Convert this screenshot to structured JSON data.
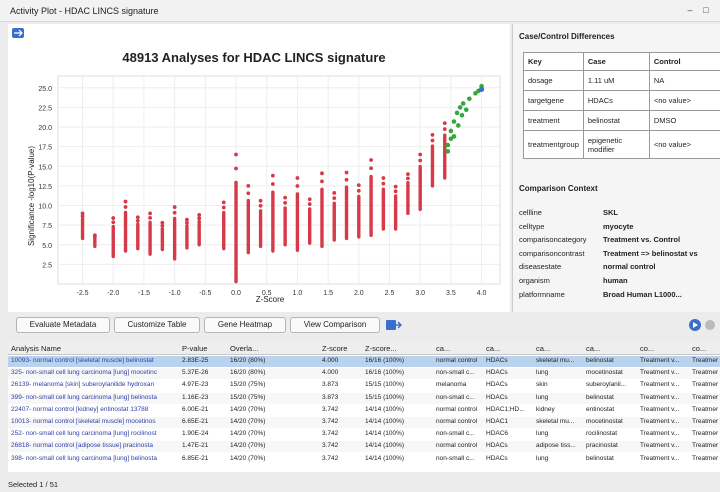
{
  "window": {
    "title": "Activity Plot - HDAC LINCS signature"
  },
  "plot": {
    "title": "48913 Analyses for HDAC LINCS signature",
    "xlabel": "Z-Score",
    "ylabel": "Significance -log10(P-value)",
    "xticks": [
      "-2.5",
      "-2.0",
      "-1.5",
      "-1.0",
      "-0.5",
      "0.0",
      "0.5",
      "1.0",
      "1.5",
      "2.0",
      "2.5",
      "3.0",
      "3.5",
      "4.0"
    ],
    "yticks": [
      "2.5",
      "5.0",
      "7.5",
      "10.0",
      "12.5",
      "15.0",
      "17.5",
      "20.0",
      "22.5",
      "25.0"
    ],
    "colors": {
      "default": "#d63a48",
      "highlight": "#33a93a",
      "selected": "#3a6fc9"
    }
  },
  "chart_data": {
    "type": "scatter",
    "title": "48913 Analyses for HDAC LINCS signature",
    "xlabel": "Z-Score",
    "ylabel": "Significance -log10(P-value)",
    "xlim": [
      -2.9,
      4.3
    ],
    "ylim": [
      0,
      26.5
    ],
    "series": [
      {
        "values_kind": "columns",
        "columns": [
          {
            "x": -2.5,
            "ymin": 5.8,
            "ymax": 9.0
          },
          {
            "x": -2.3,
            "ymin": 4.8,
            "ymax": 6.2
          },
          {
            "x": -2.0,
            "ymin": 3.5,
            "ymax": 8.4
          },
          {
            "x": -1.8,
            "ymin": 4.2,
            "ymax": 10.5
          },
          {
            "x": -1.6,
            "ymin": 4.5,
            "ymax": 8.5
          },
          {
            "x": -1.4,
            "ymin": 3.8,
            "ymax": 9.0
          },
          {
            "x": -1.2,
            "ymin": 4.4,
            "ymax": 7.8
          },
          {
            "x": -1.0,
            "ymin": 3.2,
            "ymax": 9.8
          },
          {
            "x": -0.8,
            "ymin": 4.6,
            "ymax": 8.2
          },
          {
            "x": -0.6,
            "ymin": 5.0,
            "ymax": 8.8
          },
          {
            "x": -0.2,
            "ymin": 4.5,
            "ymax": 10.4
          },
          {
            "x": 0.0,
            "ymin": 0.3,
            "ymax": 16.5
          },
          {
            "x": 0.2,
            "ymin": 4.0,
            "ymax": 12.5
          },
          {
            "x": 0.4,
            "ymin": 4.8,
            "ymax": 10.6
          },
          {
            "x": 0.6,
            "ymin": 4.2,
            "ymax": 13.8
          },
          {
            "x": 0.8,
            "ymin": 5.0,
            "ymax": 11.0
          },
          {
            "x": 1.0,
            "ymin": 4.3,
            "ymax": 13.5
          },
          {
            "x": 1.2,
            "ymin": 5.2,
            "ymax": 10.8
          },
          {
            "x": 1.4,
            "ymin": 4.8,
            "ymax": 14.1
          },
          {
            "x": 1.6,
            "ymin": 5.6,
            "ymax": 11.6
          },
          {
            "x": 1.8,
            "ymin": 5.8,
            "ymax": 14.2
          },
          {
            "x": 2.0,
            "ymin": 6.0,
            "ymax": 12.6
          },
          {
            "x": 2.2,
            "ymin": 6.2,
            "ymax": 15.8
          },
          {
            "x": 2.4,
            "ymin": 7.0,
            "ymax": 13.5
          },
          {
            "x": 2.6,
            "ymin": 7.0,
            "ymax": 12.4
          },
          {
            "x": 2.8,
            "ymin": 9.0,
            "ymax": 14.0
          },
          {
            "x": 3.0,
            "ymin": 9.5,
            "ymax": 16.5
          },
          {
            "x": 3.2,
            "ymin": 12.5,
            "ymax": 19.0
          },
          {
            "x": 3.4,
            "ymin": 13.5,
            "ymax": 20.5
          }
        ]
      },
      {
        "highlight_points": [
          [
            3.45,
            16.9
          ],
          [
            3.45,
            17.7
          ],
          [
            3.5,
            18.5
          ],
          [
            3.5,
            19.5
          ],
          [
            3.55,
            20.7
          ],
          [
            3.6,
            21.8
          ],
          [
            3.65,
            22.5
          ],
          [
            3.7,
            23.0
          ],
          [
            3.8,
            23.6
          ],
          [
            3.9,
            24.3
          ],
          [
            3.95,
            24.6
          ],
          [
            4.0,
            25.2
          ],
          [
            3.55,
            18.8
          ],
          [
            3.62,
            20.2
          ],
          [
            3.68,
            21.5
          ],
          [
            3.75,
            22.2
          ]
        ],
        "selected_point": [
          4.0,
          24.8
        ]
      }
    ]
  },
  "differences": {
    "title": "Case/Control Differences",
    "headers": [
      "Key",
      "Case",
      "Control"
    ],
    "rows": [
      {
        "key": "dosage",
        "case": "1.11 uM",
        "control": "NA"
      },
      {
        "key": "targetgene",
        "case": "HDACs",
        "control": "<no value>"
      },
      {
        "key": "treatment",
        "case": "belinostat",
        "control": "DMSO"
      },
      {
        "key": "treatmentgroup",
        "case": "epigenetic modifier",
        "control": "<no value>"
      }
    ]
  },
  "context": {
    "title": "Comparison Context",
    "rows": [
      {
        "k": "cellline",
        "v": "SKL"
      },
      {
        "k": "celltype",
        "v": "myocyte"
      },
      {
        "k": "comparisoncategory",
        "v": "Treatment vs. Control"
      },
      {
        "k": "comparisoncontrast",
        "v": "Treatment => belinostat vs"
      },
      {
        "k": "diseasestate",
        "v": "normal control"
      },
      {
        "k": "organism",
        "v": "human"
      },
      {
        "k": "platformname",
        "v": "Broad Human L1000..."
      }
    ]
  },
  "toolbar": {
    "b1": "Evaluate Metadata",
    "b2": "Customize Table",
    "b3": "Gene Heatmap",
    "b4": "View Comparison"
  },
  "grid": {
    "headers": [
      "Analysis Name",
      "P-value",
      "Overla...",
      "Z-score",
      "Z-score...",
      "ca...",
      "ca...",
      "ca...",
      "ca...",
      "co...",
      "co..."
    ],
    "rows": [
      [
        "10093- normal control [skeletal muscle] belinostat",
        "2.83E-25",
        "16/20 (80%)",
        "4.000",
        "16/16 (100%)",
        "normal control",
        "HDACs",
        "skeletal mu...",
        "belinostat",
        "Treatment v...",
        "Treatmer"
      ],
      [
        "325- non-small cell lung carcinoma [lung] mocetinc",
        "5.37E-26",
        "16/20 (80%)",
        "4.000",
        "16/16 (100%)",
        "non-small c...",
        "HDACs",
        "lung",
        "mocetinostat",
        "Treatment v...",
        "Treatmer"
      ],
      [
        "26139- melanoma [skin] suberoylanilide hydroxan",
        "4.97E-23",
        "15/20 (75%)",
        "3.873",
        "15/15 (100%)",
        "melanoma",
        "HDACs",
        "skin",
        "suberoylanil...",
        "Treatment v...",
        "Treatmer"
      ],
      [
        "399- non-small cell lung carcinoma [lung] belinosta",
        "1.16E-23",
        "15/20 (75%)",
        "3.873",
        "15/15 (100%)",
        "non-small c...",
        "HDACs",
        "lung",
        "belinostat",
        "Treatment v...",
        "Treatmer"
      ],
      [
        "22407- normal control [kidney] entinostat 13788",
        "6.00E-21",
        "14/20 (70%)",
        "3.742",
        "14/14 (100%)",
        "normal control",
        "HDAC1;HD...",
        "kidney",
        "entinostat",
        "Treatment v...",
        "Treatmer"
      ],
      [
        "10013- normal control [skeletal muscle] mocetinos",
        "6.65E-21",
        "14/20 (70%)",
        "3.742",
        "14/14 (100%)",
        "normal control",
        "HDAC1",
        "skeletal mu...",
        "mocetinostat",
        "Treatment v...",
        "Treatmer"
      ],
      [
        "252- non-small cell lung carcinoma [lung] rocilinost",
        "1.90E-24",
        "14/20 (70%)",
        "3.742",
        "14/14 (100%)",
        "non-small c...",
        "HDAC6",
        "lung",
        "rocilinostat",
        "Treatment v...",
        "Treatmer"
      ],
      [
        "26818- normal control [adipose tissue] pracinosta",
        "1.47E-21",
        "14/20 (70%)",
        "3.742",
        "14/14 (100%)",
        "normal control",
        "HDACs",
        "adipose tiss...",
        "pracinostat",
        "Treatment v...",
        "Treatmer"
      ],
      [
        "398- non-small cell lung carcinoma [lung] belinosta",
        "6.85E-21",
        "14/20 (70%)",
        "3.742",
        "14/14 (100%)",
        "non-small c...",
        "HDACs",
        "lung",
        "belinostat",
        "Treatment v...",
        "Treatmer"
      ]
    ]
  },
  "status": {
    "text": "Selected 1 / 51"
  }
}
